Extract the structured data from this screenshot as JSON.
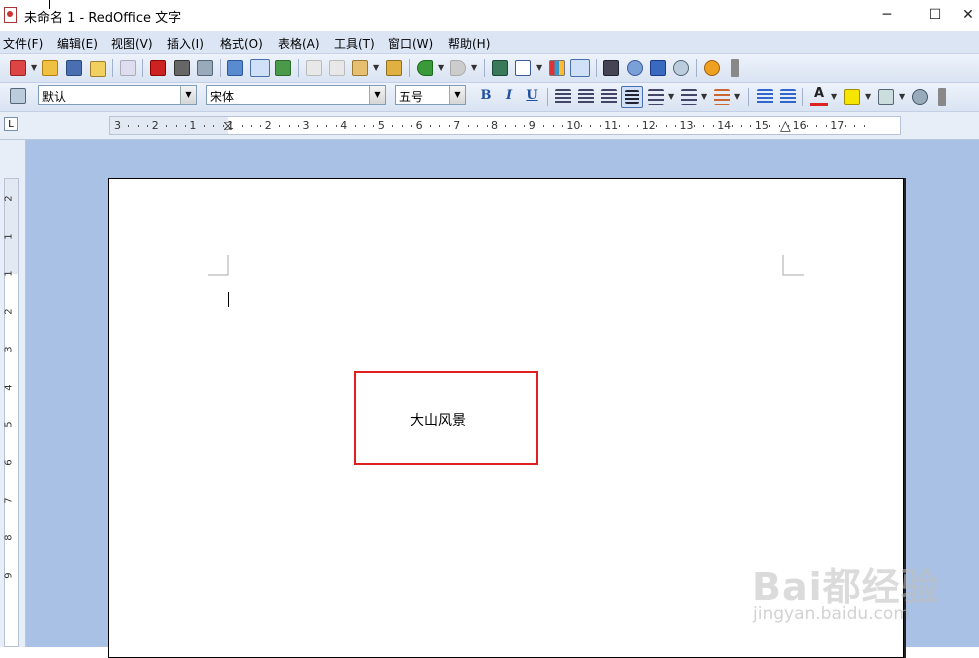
{
  "window": {
    "title": "未命名 1 - RedOffice 文字",
    "minimize": "─",
    "maximize": "☐",
    "close": "✕"
  },
  "menu": [
    "文件(F)",
    "编辑(E)",
    "视图(V)",
    "插入(I)",
    "格式(O)",
    "表格(A)",
    "工具(T)",
    "窗口(W)",
    "帮助(H)"
  ],
  "format_bar": {
    "style": "默认",
    "font": "宋体",
    "size": "五号",
    "bold": "B",
    "italic": "I",
    "underline": "U",
    "font_color_letter": "A"
  },
  "ruler": {
    "tab_selector": "L",
    "h_labels": [
      "3",
      "2",
      "1",
      "1",
      "2",
      "3",
      "4",
      "5",
      "6",
      "7",
      "8",
      "9",
      "10",
      "11",
      "12",
      "13",
      "14",
      "15",
      "16",
      "17"
    ],
    "v_labels": [
      "2",
      "1",
      "1",
      "2",
      "3",
      "4",
      "5",
      "6",
      "7",
      "8",
      "9"
    ]
  },
  "document": {
    "textbox_text": "大山风景"
  },
  "watermark": {
    "logo": "Bai都经验",
    "url": "jingyan.baidu.com"
  },
  "colors": {
    "accent_blue": "#dbe5f4",
    "doc_background": "#a9c1e4",
    "highlight_red": "#e02020"
  }
}
